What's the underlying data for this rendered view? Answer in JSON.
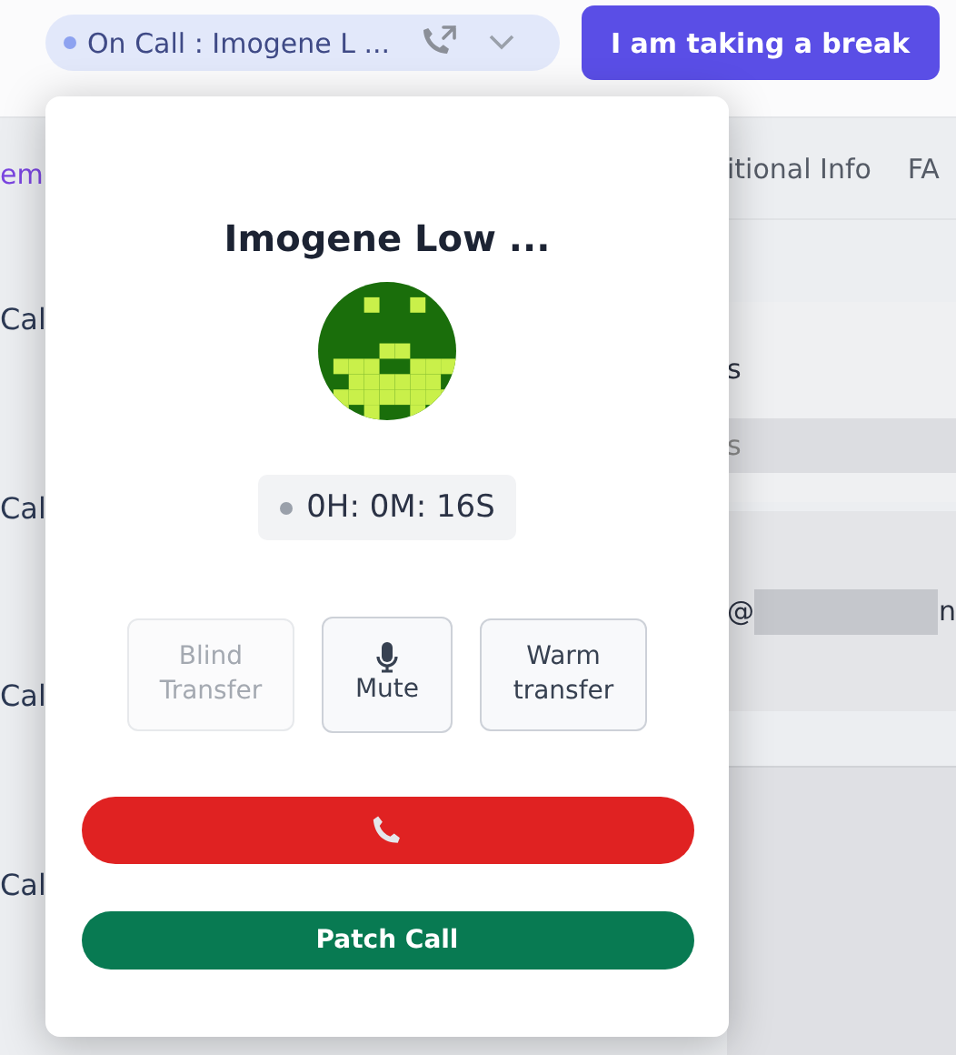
{
  "status_pill": {
    "label": "On Call : Imogene L ..."
  },
  "break_button": {
    "label": "I am taking a break"
  },
  "background": {
    "left_tab": "em",
    "row_labels": [
      "Cal",
      "Cal",
      "Cal",
      "Cal"
    ],
    "tabs": [
      "itional Info",
      "FA"
    ],
    "detail_texts": [
      "s",
      "s",
      "@",
      "n"
    ]
  },
  "call_panel": {
    "name": "Imogene Low ...",
    "timer": "0H: 0M: 16S",
    "actions": [
      {
        "label": "Blind Transfer",
        "disabled": true,
        "kind": "text"
      },
      {
        "label": "Mute",
        "disabled": false,
        "kind": "mic"
      },
      {
        "label": "Warm transfer",
        "disabled": false,
        "kind": "text"
      }
    ],
    "patch_button": {
      "label": "Patch Call"
    }
  }
}
